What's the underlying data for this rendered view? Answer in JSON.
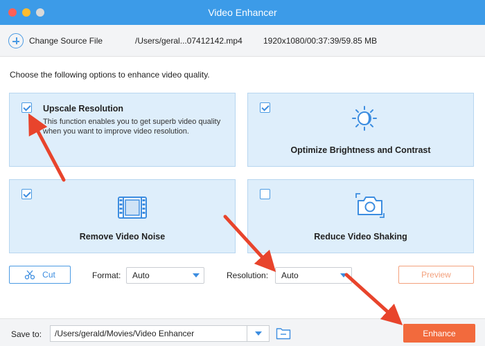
{
  "window": {
    "title": "Video Enhancer"
  },
  "source": {
    "change_label": "Change Source File",
    "file_path": "/Users/geral...07412142.mp4",
    "file_meta": "1920x1080/00:37:39/59.85 MB"
  },
  "instruction": "Choose the following options to enhance video quality.",
  "options": [
    {
      "title": "Upscale Resolution",
      "checked": true,
      "description": "This function enables you to get superb video quality when you want to improve video resolution.",
      "icon": ""
    },
    {
      "title": "Optimize Brightness and Contrast",
      "checked": true,
      "icon": "brightness-icon"
    },
    {
      "title": "Remove Video Noise",
      "checked": true,
      "icon": "film-icon"
    },
    {
      "title": "Reduce Video Shaking",
      "checked": false,
      "icon": "camera-icon"
    }
  ],
  "controls": {
    "cut_label": "Cut",
    "format_label": "Format:",
    "format_value": "Auto",
    "resolution_label": "Resolution:",
    "resolution_value": "Auto",
    "preview_label": "Preview"
  },
  "save": {
    "label": "Save to:",
    "path": "/Users/gerald/Movies/Video Enhancer",
    "enhance_label": "Enhance"
  },
  "colors": {
    "titlebar": "#3c9be8",
    "accent": "#3c8de0",
    "card_bg": "#deeefb",
    "enhance": "#f26a3d",
    "annotation_arrow": "#e8442c"
  }
}
